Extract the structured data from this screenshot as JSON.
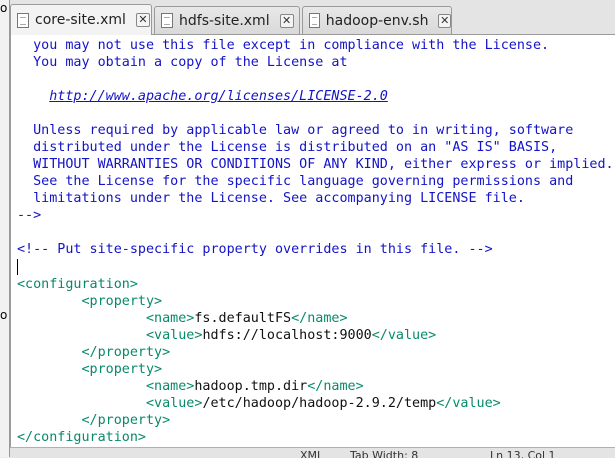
{
  "left_strip": {
    "glyph_top": "o",
    "glyph_bottom": "o"
  },
  "tabs": [
    {
      "label": "core-site.xml",
      "active": true
    },
    {
      "label": "hdfs-site.xml",
      "active": false
    },
    {
      "label": "hadoop-env.sh",
      "active": false
    }
  ],
  "editor": {
    "lines": [
      "  you may not use this file except in compliance with the License.",
      "  You may obtain a copy of the License at",
      "",
      "    http://www.apache.org/licenses/LICENSE-2.0",
      "",
      "  Unless required by applicable law or agreed to in writing, software",
      "  distributed under the License is distributed on an \"AS IS\" BASIS,",
      "  WITHOUT WARRANTIES OR CONDITIONS OF ANY KIND, either express or implied.",
      "  See the License for the specific language governing permissions and",
      "  limitations under the License. See accompanying LICENSE file.",
      "-->",
      "",
      "<!-- Put site-specific property overrides in this file. -->",
      "",
      "<configuration>",
      "        <property>",
      "                <name>fs.defaultFS</name>",
      "                <value>hdfs://localhost:9000</value>",
      "        </property>",
      "        <property>",
      "                <name>hadoop.tmp.dir</name>",
      "                <value>/etc/hadoop/hadoop-2.9.2/temp</value>",
      "        </property>",
      "</configuration>"
    ],
    "license_url": "http://www.apache.org/licenses/LICENSE-2.0",
    "config": {
      "open_tag": "<configuration>",
      "close_tag": "</configuration>",
      "property_open": "<property>",
      "property_close": "</property>",
      "name_open": "<name>",
      "name_close": "</name>",
      "value_open": "<value>",
      "value_close": "</value>",
      "properties": [
        {
          "name": "fs.defaultFS",
          "value": "hdfs://localhost:9000"
        },
        {
          "name": "hadoop.tmp.dir",
          "value": "/etc/hadoop/hadoop-2.9.2/temp"
        }
      ]
    }
  },
  "colors": {
    "comment": "#1313c8",
    "tag": "#088a6a",
    "text": "#111111"
  },
  "statusbar": {
    "left_text": "XML",
    "middle_text": "Tab Width: 8",
    "right_text": "Ln 13, Col 1"
  }
}
